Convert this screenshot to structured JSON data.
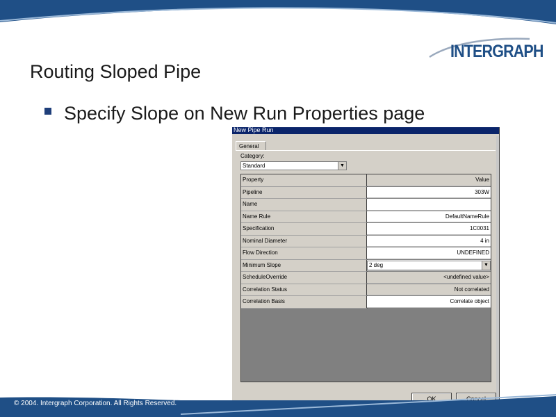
{
  "slide": {
    "title": "Routing Sloped Pipe",
    "bullet": "Specify Slope on New Run Properties page",
    "logo": "INTERGRAPH",
    "copyright": "© 2004. Intergraph Corporation. All Rights Reserved."
  },
  "dialog": {
    "title": "New Pipe Run",
    "tab": "General",
    "category_label": "Category:",
    "category_value": "Standard",
    "header": {
      "property": "Property",
      "value": "Value"
    },
    "rows": [
      {
        "property": "Pipeline",
        "value": "303W"
      },
      {
        "property": "Name",
        "value": ""
      },
      {
        "property": "Name Rule",
        "value": "DefaultNameRule"
      },
      {
        "property": "Specification",
        "value": "1C0031"
      },
      {
        "property": "Nominal Diameter",
        "value": "4 in"
      },
      {
        "property": "Flow Direction",
        "value": "UNDEFINED"
      },
      {
        "property": "Minimum Slope",
        "value": "2 deg"
      },
      {
        "property": "ScheduleOverride",
        "value": "<undefined value>"
      },
      {
        "property": "Correlation Status",
        "value": "Not correlated"
      },
      {
        "property": "Correlation Basis",
        "value": "Correlate object"
      }
    ],
    "ok_label": "OK",
    "cancel_label": "Cancel"
  },
  "colors": {
    "brand_blue": "#1f4f86",
    "title_bar": "#0a246a",
    "dialog_face": "#d4d0c8"
  },
  "icons": {
    "dropdown": "chevron-down-icon",
    "bullet": "square-bullet-icon"
  }
}
